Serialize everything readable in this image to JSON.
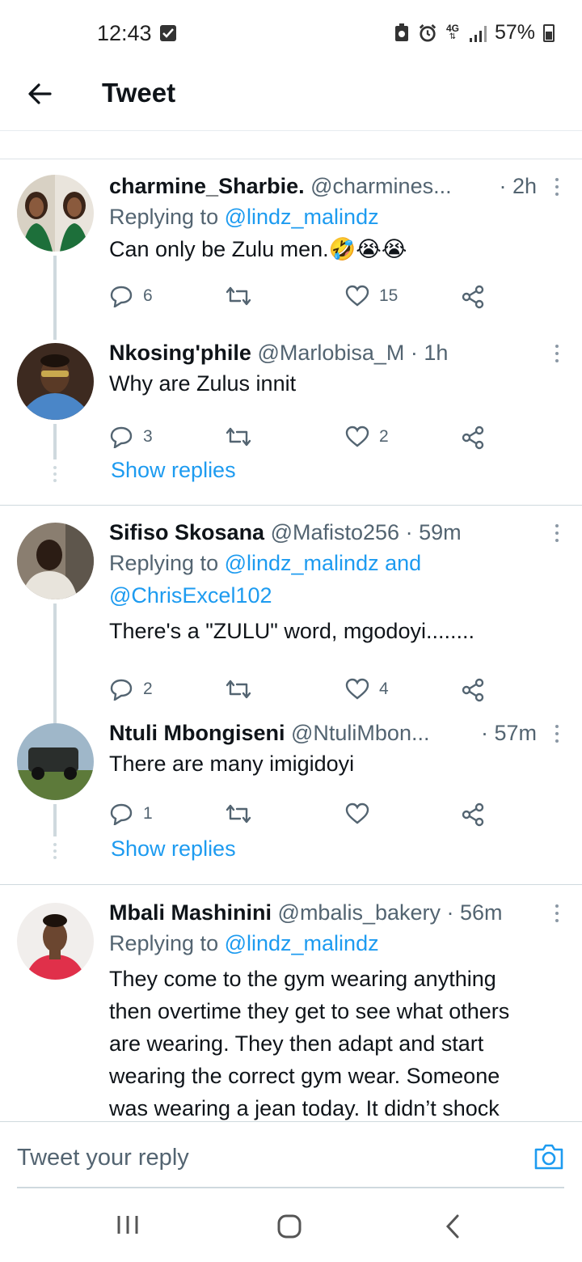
{
  "status": {
    "time": "12:43",
    "network": "4G",
    "battery": "57%",
    "icons": [
      "screenshot-check-icon",
      "battery-saver-icon",
      "alarm-icon",
      "4g-icon",
      "signal-icon",
      "battery-icon"
    ]
  },
  "header": {
    "title": "Tweet"
  },
  "tweets": [
    {
      "name": "charmine_Sharbie.",
      "handle": "@charmines...",
      "time": "· 2h",
      "replying_prefix": "Replying to ",
      "replying_to": "@lindz_malindz",
      "text": "Can only be Zulu men.🤣😭😭",
      "replies": "6",
      "retweets": "",
      "likes": "15"
    },
    {
      "name": "Nkosing'phile",
      "handle": "@Marlobisa_M · 1h",
      "text": "Why are Zulus innit",
      "replies": "3",
      "retweets": "",
      "likes": "2",
      "show_replies": "Show replies"
    },
    {
      "name": "Sifiso Skosana",
      "handle": "@Mafisto256 · 59m",
      "replying_prefix": "Replying to ",
      "replying_to": "@lindz_malindz and",
      "replying_to_2": "@ChrisExcel102",
      "text": "There's a \"ZULU\" word, mgodoyi........",
      "replies": "2",
      "retweets": "",
      "likes": "4"
    },
    {
      "name": "Ntuli Mbongiseni",
      "handle": "@NtuliMbon...",
      "time": "· 57m",
      "text": "There are many imigidoyi",
      "replies": "1",
      "retweets": "",
      "likes": "",
      "show_replies": "Show replies"
    },
    {
      "name": "Mbali Mashinini",
      "handle": "@mbalis_bakery · 56m",
      "replying_prefix": "Replying to ",
      "replying_to": "@lindz_malindz",
      "text_lines": [
        "They come to the gym wearing anything",
        "then overtime they get to see what others",
        "are wearing. They then adapt and start",
        "wearing the correct gym wear. Someone",
        "was wearing a jean today. It didn’t shock"
      ]
    }
  ],
  "compose": {
    "placeholder": "Tweet your reply"
  },
  "colors": {
    "accent": "#1d9bf0",
    "secondary_text": "#536471",
    "border": "#cfd9de"
  }
}
